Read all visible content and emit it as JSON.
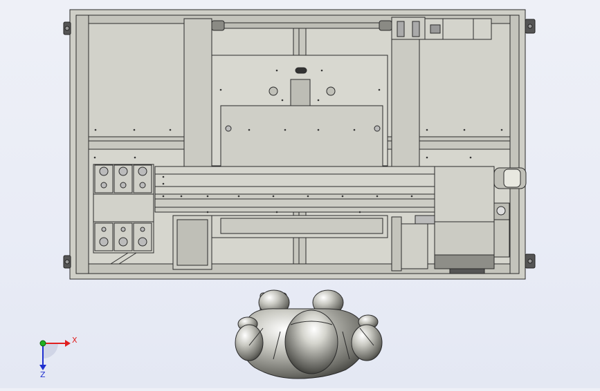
{
  "viewport": {
    "background_top": "#eef0f7",
    "background_bottom": "#e4e8f3"
  },
  "triad": {
    "x_label": "X",
    "z_label": "Z",
    "x_color": "#e02020",
    "y_color": "#20b020",
    "z_color": "#2030d0"
  },
  "model": {
    "frame_color": "#c8c8c0",
    "panel_color": "#d0d0c8",
    "edge_color": "#2a2a2a",
    "figure_color": "#bfbfb8"
  }
}
